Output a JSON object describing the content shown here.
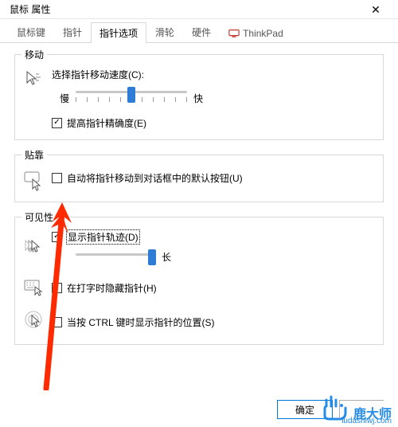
{
  "window": {
    "title": "鼠标 属性"
  },
  "tabs": {
    "t0": "鼠标键",
    "t1": "指针",
    "t2": "指针选项",
    "t3": "滑轮",
    "t4": "硬件",
    "t5": "ThinkPad"
  },
  "motion": {
    "legend": "移动",
    "speed_label": "选择指针移动速度(C):",
    "slow": "慢",
    "fast": "快",
    "precision_label": "提高指针精确度(E)"
  },
  "snap": {
    "legend": "贴靠",
    "auto_move_label": "自动将指针移动到对话框中的默认按钮(U)"
  },
  "visibility": {
    "legend": "可见性",
    "trails_label": "显示指针轨迹(D)",
    "trail_long": "长",
    "hide_typing_label": "在打字时隐藏指针(H)",
    "ctrl_locate_label": "当按 CTRL 键时显示指针的位置(S)"
  },
  "buttons": {
    "ok": "确定"
  },
  "watermark": {
    "brand": "鹿大师",
    "url": "ludashiwj.com"
  }
}
